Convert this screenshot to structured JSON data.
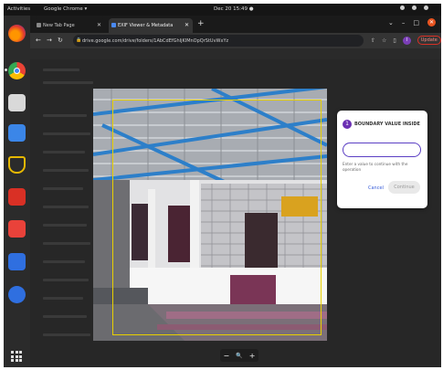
{
  "system_bar": {
    "activities": "Activities",
    "app_name": "Google Chrome ▾",
    "clock": "Dec 20  15:49  ●",
    "tray": [
      "network",
      "volume",
      "power"
    ]
  },
  "dock": {
    "apps": [
      "firefox-icon",
      "chrome-icon",
      "files-icon",
      "docs-icon",
      "security-icon",
      "pdf-icon",
      "software-icon",
      "vpn-icon",
      "tool-icon"
    ]
  },
  "browser": {
    "tabs": [
      {
        "label": "New Tab Page",
        "active": false
      },
      {
        "label": "EXIF Viewer & Metadata",
        "active": true
      }
    ],
    "new_tab": "+",
    "url": "drive.google.com/drive/folders/1AbCdEfGhIjKlMnOpQrStUvWxYz",
    "update_label": "Update"
  },
  "image_viewer": {
    "zoom_out": "−",
    "zoom_icon": "🔍",
    "zoom_in": "+"
  },
  "dialog": {
    "step": "1",
    "title": "BOUNDARY VALUE INSIDE",
    "input_value": "",
    "help_text": "Enter a value to continue with the operation",
    "cancel_label": "Cancel",
    "continue_label": "Continue"
  },
  "colors": {
    "accent": "#5b3fc4",
    "crop_border": "#e8d000",
    "ubuntu_orange": "#e95420"
  }
}
